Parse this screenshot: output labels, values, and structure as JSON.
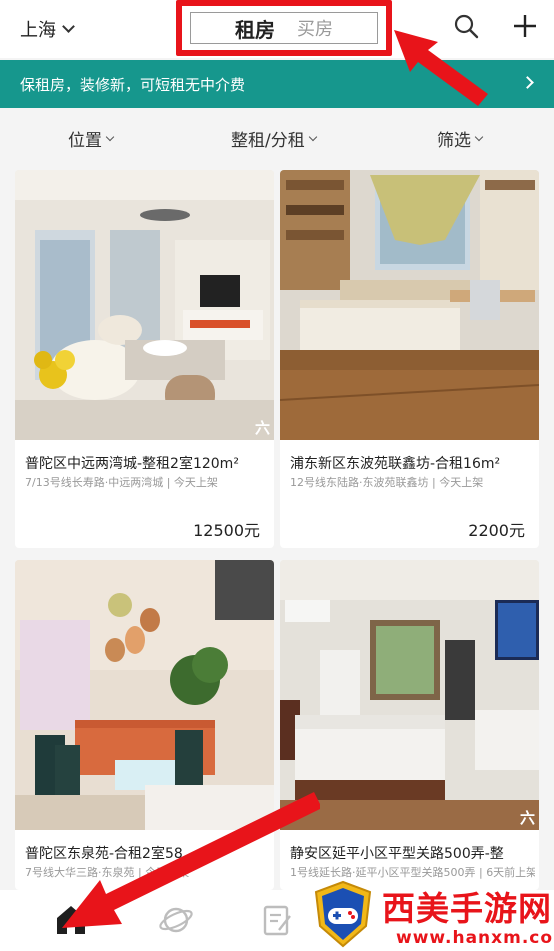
{
  "header": {
    "city": "上海",
    "tabs": [
      {
        "label": "租房",
        "active": true
      },
      {
        "label": "买房",
        "active": false
      }
    ],
    "icons": [
      "search-icon",
      "plus-icon"
    ]
  },
  "banner": {
    "text": "保租房，装修新，可短租无中介费"
  },
  "filters": [
    {
      "label": "位置"
    },
    {
      "label": "整租/分租"
    },
    {
      "label": "筛选"
    }
  ],
  "listings": [
    {
      "title": "普陀区中远两湾城-整租2室120m²",
      "subtitle": "7/13号线长寿路·中远两湾城 | 今天上架",
      "price": "12500元",
      "badge": "六"
    },
    {
      "title": "浦东新区东波苑联鑫坊-合租16m²",
      "subtitle": "12号线东陆路·东波苑联鑫坊 | 今天上架",
      "price": "2200元",
      "badge": ""
    },
    {
      "title": "普陀区东泉苑-合租2室58",
      "subtitle": "7号线大华三路·东泉苑 | 今天上架",
      "price": "",
      "badge": ""
    },
    {
      "title": "静安区延平小区平型关路500弄-整",
      "subtitle": "1号线延长路·延平小区平型关路500弄 | 6天前上架",
      "price": "",
      "badge": "六"
    }
  ],
  "watermark": {
    "title": "西美手游网",
    "url": "www.hanxm.com"
  },
  "colors": {
    "accent": "#16978d",
    "annotation_red": "#e8141a"
  }
}
